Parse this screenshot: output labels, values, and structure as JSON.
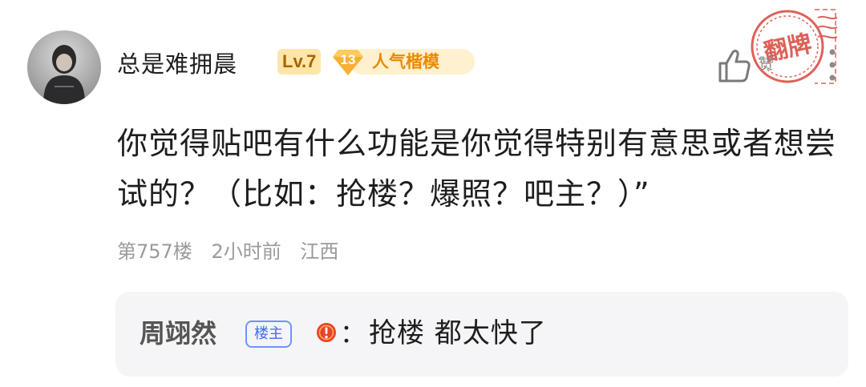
{
  "comment": {
    "username": "总是难拥晨",
    "level_badge": "Lv.7",
    "honor_badge": {
      "number": "13",
      "title": "人气楷模"
    },
    "like_label": "赞",
    "stamp_text": "翻牌",
    "content": "你觉得贴吧有什么功能是你觉得特别有意思或者想尝试的？（比如：抢楼？爆照？吧主？）”",
    "floor": "第757楼",
    "time": "2小时前",
    "location": "江西"
  },
  "reply": {
    "author": "周翊然",
    "op_tag": "楼主",
    "colon": "：",
    "text": "抢楼 都太快了"
  },
  "colors": {
    "level_badge_bg": "#ffe6a8",
    "honor_accent": "#f5a623",
    "op_tag_blue": "#3f6cf5",
    "reply_icon_red": "#e8432d",
    "stamp_red": "#d8463c"
  },
  "icons": [
    "avatar-photo",
    "honor-diamond-icon",
    "thumbs-up-icon",
    "more-dots-icon",
    "info-icon"
  ]
}
